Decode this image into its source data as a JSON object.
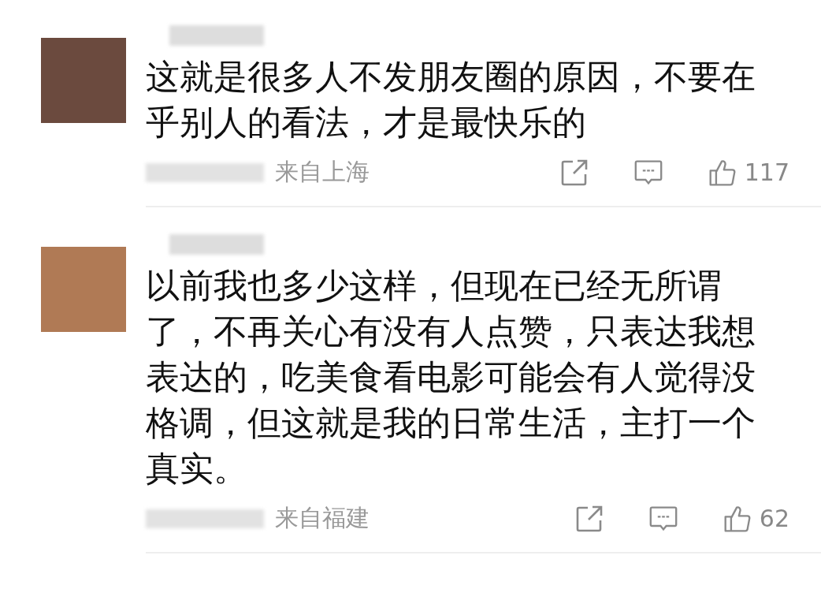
{
  "comments": [
    {
      "text": "这就是很多人不发朋友圈的原因，不要在乎别人的看法，才是最快乐的",
      "location": "来自上海",
      "likes": "117"
    },
    {
      "text": "以前我也多少这样，但现在已经无所谓了，不再关心有没有人点赞，只表达我想表达的，吃美食看电影可能会有人觉得没格调，但这就是我的日常生活，主打一个真实。",
      "location": "来自福建",
      "likes": "62"
    }
  ]
}
